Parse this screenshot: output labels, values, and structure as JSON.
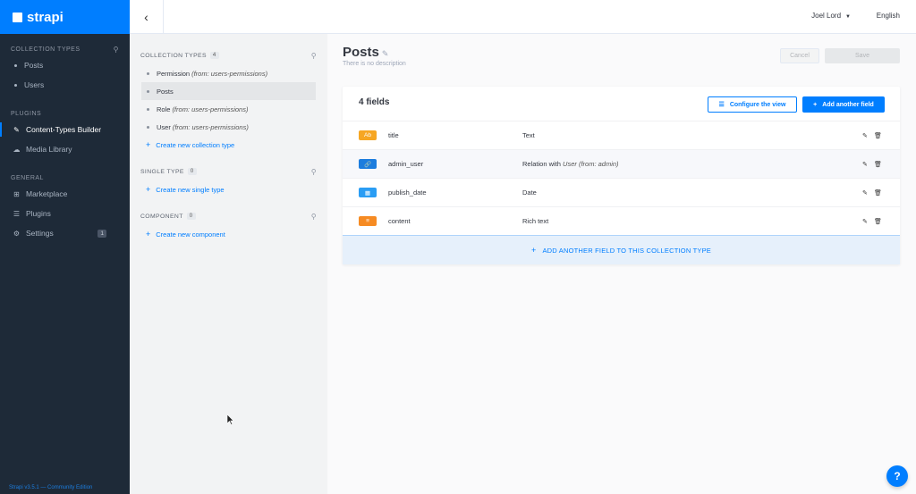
{
  "app": {
    "logo_text": "strapi"
  },
  "leftnav": {
    "collection_types_title": "COLLECTION TYPES",
    "collection_items": [
      {
        "label": "Posts"
      },
      {
        "label": "Users"
      }
    ],
    "plugins_title": "PLUGINS",
    "plugin_items": [
      {
        "label": "Content-Types Builder",
        "icon": "brush-icon"
      },
      {
        "label": "Media Library",
        "icon": "cloud-icon"
      }
    ],
    "general_title": "GENERAL",
    "general_items": [
      {
        "label": "Marketplace",
        "icon": "basket-icon"
      },
      {
        "label": "Plugins",
        "icon": "list-icon"
      },
      {
        "label": "Settings",
        "icon": "gear-icon",
        "badge": "1"
      }
    ],
    "footer": "Strapi v3.5.1 — Community Edition"
  },
  "topbar": {
    "user": "Joel Lord",
    "language": "English"
  },
  "subnav": {
    "collection_types": {
      "title": "COLLECTION TYPES",
      "count": "4"
    },
    "collection_items": [
      {
        "label": "Permission",
        "suffix": "(from: users-permissions)"
      },
      {
        "label": "Posts",
        "suffix": ""
      },
      {
        "label": "Role",
        "suffix": "(from: users-permissions)"
      },
      {
        "label": "User",
        "suffix": "(from: users-permissions)"
      }
    ],
    "create_collection": "Create new collection type",
    "single_type": {
      "title": "SINGLE TYPE",
      "count": "0"
    },
    "create_single": "Create new single type",
    "component": {
      "title": "COMPONENT",
      "count": "0"
    },
    "create_component": "Create new component"
  },
  "main": {
    "title": "Posts",
    "description": "There is no description",
    "cancel_label": "Cancel",
    "save_label": "Save",
    "fields_count": "4 fields",
    "configure_label": "Configure the view",
    "add_field_label": "Add another field",
    "fields": [
      {
        "tag": "Ab",
        "tag_color": "#f6a623",
        "name": "title",
        "type": "Text",
        "type_italic": ""
      },
      {
        "tag": "🔗",
        "tag_color": "#1c7dde",
        "name": "admin_user",
        "type": "Relation with",
        "type_italic": "User (from: admin)"
      },
      {
        "tag": "▦",
        "tag_color": "#2a9df4",
        "name": "publish_date",
        "type": "Date",
        "type_italic": ""
      },
      {
        "tag": "≡",
        "tag_color": "#f68b23",
        "name": "content",
        "type": "Rich text",
        "type_italic": ""
      }
    ],
    "add_bar_label": "ADD ANOTHER FIELD TO THIS COLLECTION TYPE"
  },
  "help_label": "?",
  "colors": {
    "accent": "#007eff",
    "nav_bg": "#1e2a38"
  }
}
